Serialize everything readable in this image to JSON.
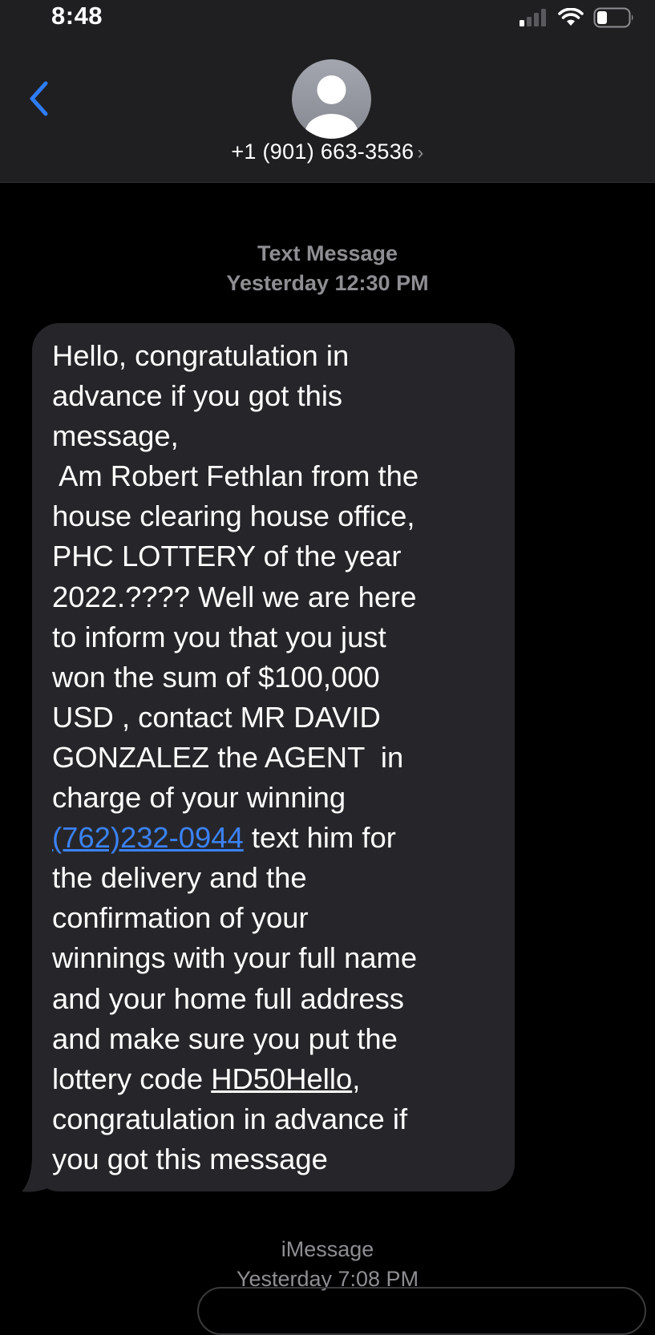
{
  "status_bar": {
    "time": "8:48",
    "signal_icon": "cellular-signal-icon",
    "wifi_icon": "wifi-icon",
    "battery_icon": "battery-icon"
  },
  "header": {
    "back_icon": "chevron-left-icon",
    "avatar_icon": "person-icon",
    "contact_number": "+1 (901) 663-3536",
    "contact_chevron": "›"
  },
  "thread": {
    "first_label": "Text Message",
    "first_timestamp": "Yesterday 12:30 PM",
    "message": {
      "lines": [
        "Hello, congratulation in",
        "advance if you got this",
        "message,",
        " Am Robert Fethlan from the",
        "house clearing house office,",
        "PHC LOTTERY of the year",
        "2022.???? Well we are here",
        "to inform you that you just",
        "won the sum of $100,000",
        "USD , contact MR DAVID",
        "GONZALEZ the AGENT  in",
        "charge of your winning"
      ],
      "phone_link": "(762)232-0944",
      "after_phone": " text him for",
      "lines2": [
        "the delivery and the",
        "confirmation of your",
        "winnings with your full name",
        "and your home full address",
        "and make sure you put the"
      ],
      "before_code": "lottery code ",
      "code_link": "HD50Hello",
      "after_code": ",",
      "lines3": [
        "congratulation in advance if",
        "you got this message"
      ]
    },
    "second_label": "iMessage",
    "second_timestamp": "Yesterday 7:08 PM"
  },
  "colors": {
    "header_bg": "#1f1f21",
    "bubble_bg": "#26262a",
    "link": "#3b82f6",
    "meta_gray": "#8e8e93",
    "ios_blue": "#2f7cf6"
  }
}
